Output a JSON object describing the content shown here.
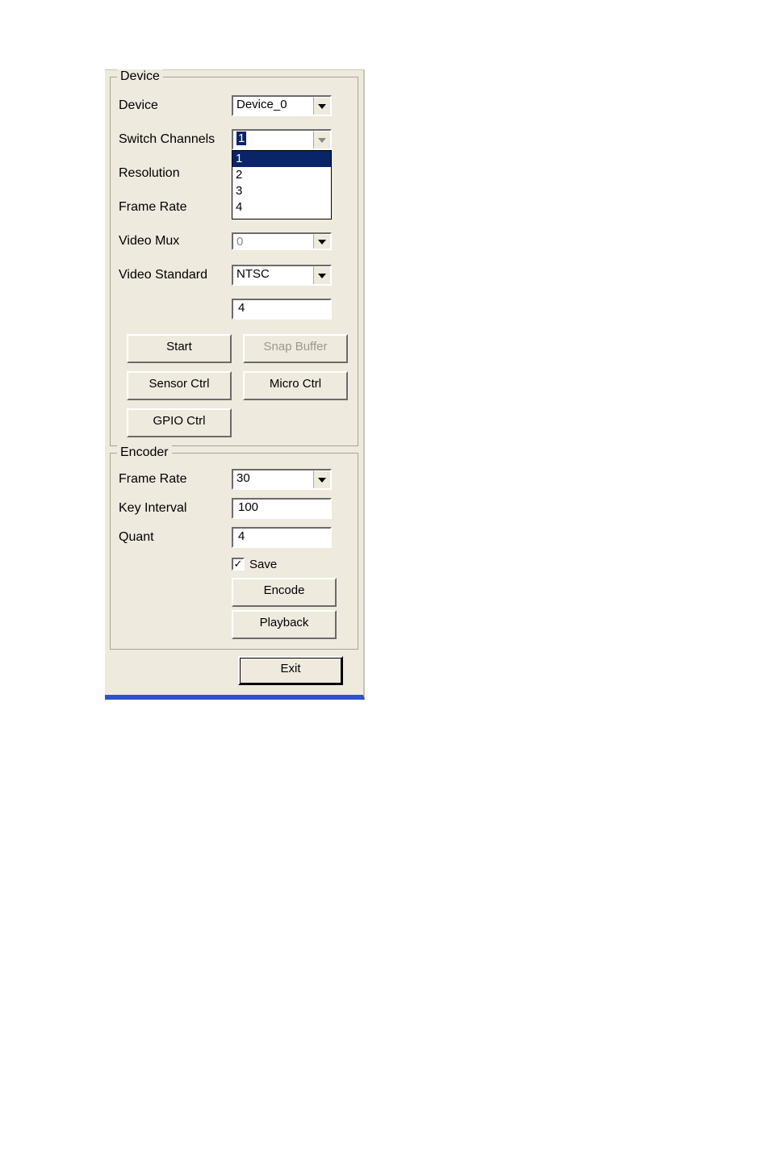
{
  "device_group": {
    "title": "Device",
    "labels": {
      "device": "Device",
      "switch_channels": "Switch Channels",
      "resolution": "Resolution",
      "frame_rate": "Frame Rate",
      "video_mux": "Video Mux",
      "video_standard": "Video Standard"
    },
    "values": {
      "device": "Device_0",
      "switch_channels": "1",
      "switch_channels_options": [
        "1",
        "2",
        "3",
        "4"
      ],
      "video_mux": "0",
      "video_standard": "NTSC",
      "readonly_box": "4"
    },
    "buttons": {
      "start": "Start",
      "snap_buffer": "Snap Buffer",
      "sensor_ctrl": "Sensor Ctrl",
      "micro_ctrl": "Micro Ctrl",
      "gpio_ctrl": "GPIO Ctrl"
    }
  },
  "encoder_group": {
    "title": "Encoder",
    "labels": {
      "frame_rate": "Frame Rate",
      "key_interval": "Key Interval",
      "quant": "Quant"
    },
    "values": {
      "frame_rate": "30",
      "key_interval": "100",
      "quant": "4"
    },
    "save_checkbox": {
      "label": "Save",
      "checked": true
    },
    "buttons": {
      "encode": "Encode",
      "playback": "Playback"
    }
  },
  "exit_button": "Exit"
}
